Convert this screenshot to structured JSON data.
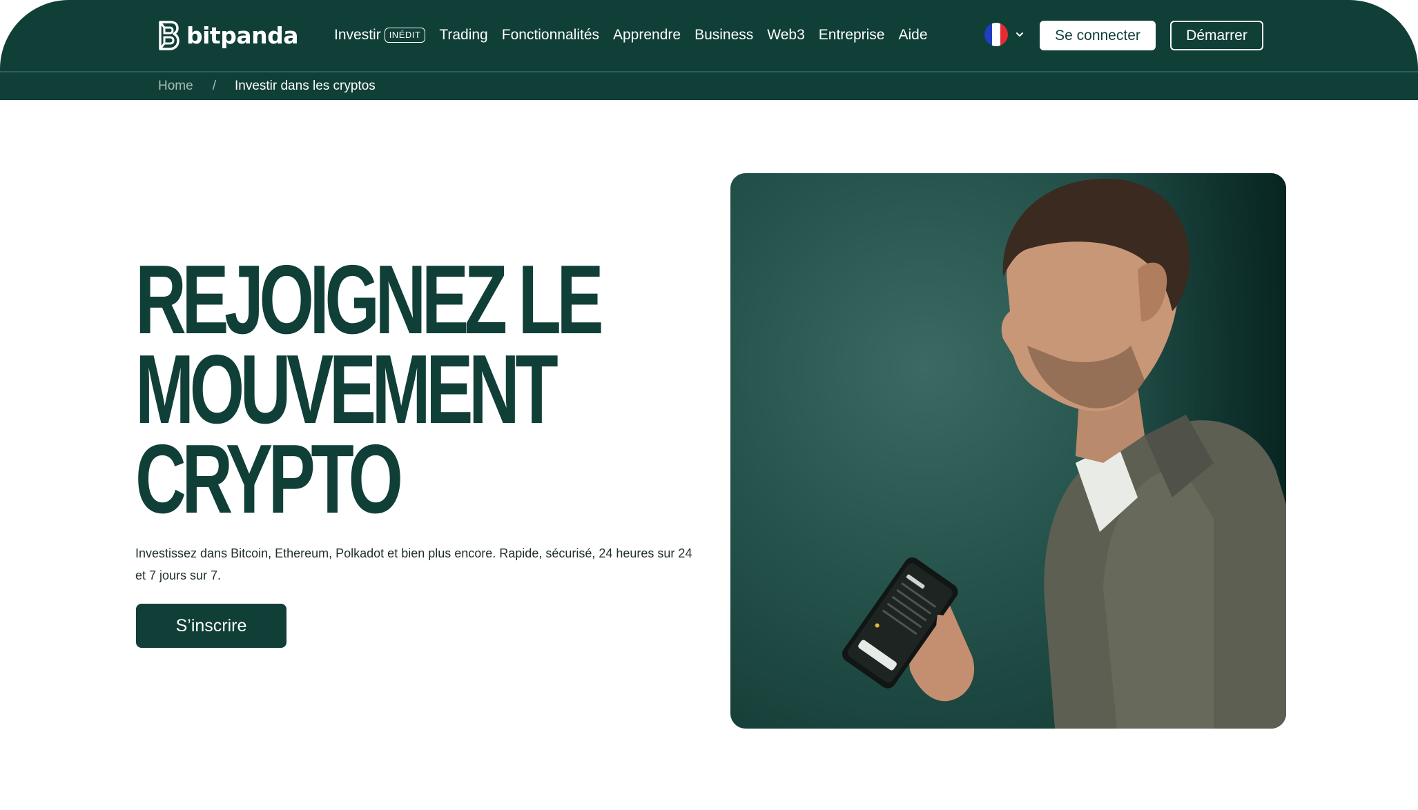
{
  "header": {
    "logo_text": "bitpanda",
    "nav": [
      {
        "label": "Investir",
        "badge": "INÉDIT"
      },
      {
        "label": "Trading"
      },
      {
        "label": "Fonctionnalités"
      },
      {
        "label": "Apprendre"
      },
      {
        "label": "Business"
      },
      {
        "label": "Web3"
      },
      {
        "label": "Entreprise"
      },
      {
        "label": "Aide"
      }
    ],
    "language_flag": "fr-flag-icon",
    "login_label": "Se connecter",
    "start_label": "Démarrer"
  },
  "breadcrumb": {
    "home": "Home",
    "separator": "/",
    "current": "Investir dans les cryptos"
  },
  "hero": {
    "title_lines": [
      "REJOIGNEZ LE",
      "MOUVEMENT",
      "CRYPTO"
    ],
    "description": "Investissez dans Bitcoin, Ethereum, Polkadot et bien plus encore. Rapide, sécurisé, 24 heures sur 24 et 7 jours sur 7.",
    "cta_label": "S’inscrire",
    "image": "man-holding-phone-photo"
  },
  "colors": {
    "brand_dark_green": "#103f38",
    "white": "#ffffff"
  }
}
